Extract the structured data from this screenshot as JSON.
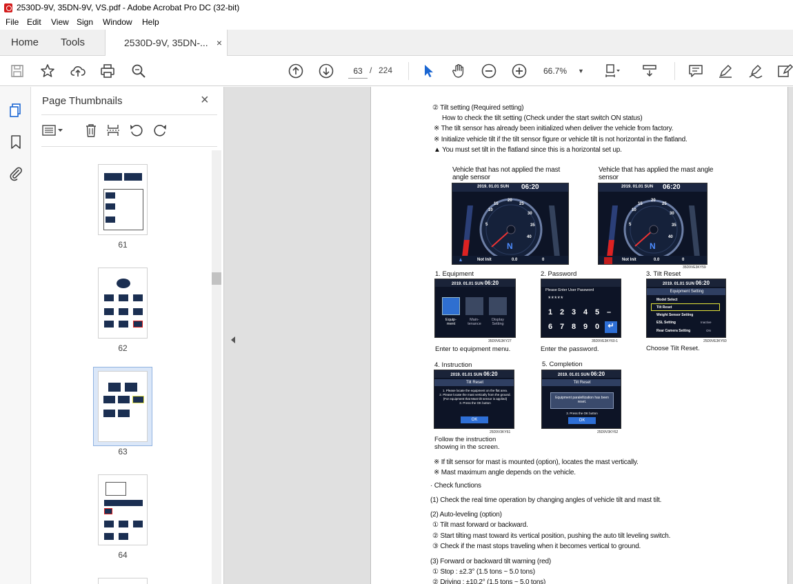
{
  "window": {
    "title": "2530D-9V, 35DN-9V, VS.pdf - Adobe Acrobat Pro DC (32-bit)"
  },
  "menu": [
    "File",
    "Edit",
    "View",
    "Sign",
    "Window",
    "Help"
  ],
  "tabs": {
    "home": "Home",
    "tools": "Tools",
    "document": "2530D-9V, 35DN-...",
    "close": "×"
  },
  "toolbar": {
    "page_current": "63",
    "page_sep": "/",
    "page_total": "224",
    "zoom": "66.7%"
  },
  "thumbnails": {
    "header": "Page Thumbnails",
    "close": "×",
    "pages": [
      "61",
      "62",
      "63",
      "64"
    ],
    "selected": "63"
  },
  "doc": {
    "heading": "② Tilt setting (Required setting)",
    "how": "How to check the tilt setting (Check under the start switch ON status)",
    "note1": "※ The tilt sensor has already been initialized when deliver the vehicle from factory.",
    "note2": "※ Initialize vehicle tilt if the tilt sensor figure or vehicle tilt is not horizontal in the flatland.",
    "warn": "You must set tilt in the flatland since this is a horizontal set up.",
    "fig_left_title": "Vehicle that has not applied the mast angle sensor",
    "fig_right_title": "Vehicle that has applied the mast angle sensor",
    "dash_date": "2019. 01.01 SUN",
    "dash_time": "06:20",
    "dash_status": "Not Init",
    "dash_value": "0.0",
    "dash_zero": "0",
    "dash_gear": "N",
    "speed_ticks": [
      "5",
      "10",
      "15",
      "20",
      "25",
      "30",
      "35",
      "40"
    ],
    "fig_code_top": "35D9VE3KY59",
    "step1": {
      "label": "1. Equipment",
      "caption": "Enter to equipment menu.",
      "code": "35D9VE3KY27",
      "icons": [
        "Equip-\nment",
        "Main-\ntenance",
        "Display\nSetting"
      ]
    },
    "step2": {
      "label": "2. Password",
      "caption": "Enter the password.",
      "code": "35D9VE3KY60-1",
      "prompt": "Please Enter User Password",
      "dots": "*****",
      "keys": [
        "1",
        "2",
        "3",
        "4",
        "5",
        "–",
        "6",
        "7",
        "8",
        "9",
        "0",
        "↵"
      ]
    },
    "step3": {
      "label": "3. Tilt Reset",
      "caption": "Choose Tilt Reset.",
      "code": "25D9VE3KY60",
      "title": "Equipment Setting",
      "items": [
        "Model Select",
        "Tilt Reset",
        "Weight Sensor Setting",
        "ESL Setting",
        "Rear Camera Setting"
      ],
      "values": [
        "",
        "",
        "",
        "Inactive",
        "ON"
      ]
    },
    "step4": {
      "label": "4. Instruction",
      "caption": "Follow the instruction showing in the screen.",
      "code": "25D9V3KY61",
      "title": "Tilt Reset",
      "lines": [
        "1. Please locate the equipment on the flat area.",
        "2. Please locate the mast vertically from the ground.",
        "(For equipment that Mast tilt sensor is applied)",
        "3. Press the OK button"
      ],
      "ok": "OK"
    },
    "step5": {
      "label": "5. Completion",
      "code": "25D9V3KY62",
      "title": "Tilt Reset",
      "msg": "Equipment paralellization has been reset.",
      "line": "3. Press the OK button",
      "ok": "OK"
    },
    "note3": "※ If tilt sensor for mast is mounted (option), locates the mast vertically.",
    "note4": "※ Mast maximum angle depends on the vehicle.",
    "check": "· Check functions",
    "c1": "(1) Check the real time operation by changing angles of vehicle tilt and mast tilt.",
    "c2": "(2) Auto-leveling (option)",
    "c2a": "① Tilt mast forward or backward.",
    "c2b": "② Start tilting mast toward its vertical position, pushing the auto tilt leveling switch.",
    "c2c": "③ Check if the mast stops traveling when it becomes vertical to ground.",
    "c3": "(3) Forward or backward tilt warning (red)",
    "c3a": "① Stop : ±2.3° (1.5 tons ~ 5.0 tons)",
    "c3b": "② Driving : ±10.2° (1.5 tons ~ 5.0 tons)"
  }
}
